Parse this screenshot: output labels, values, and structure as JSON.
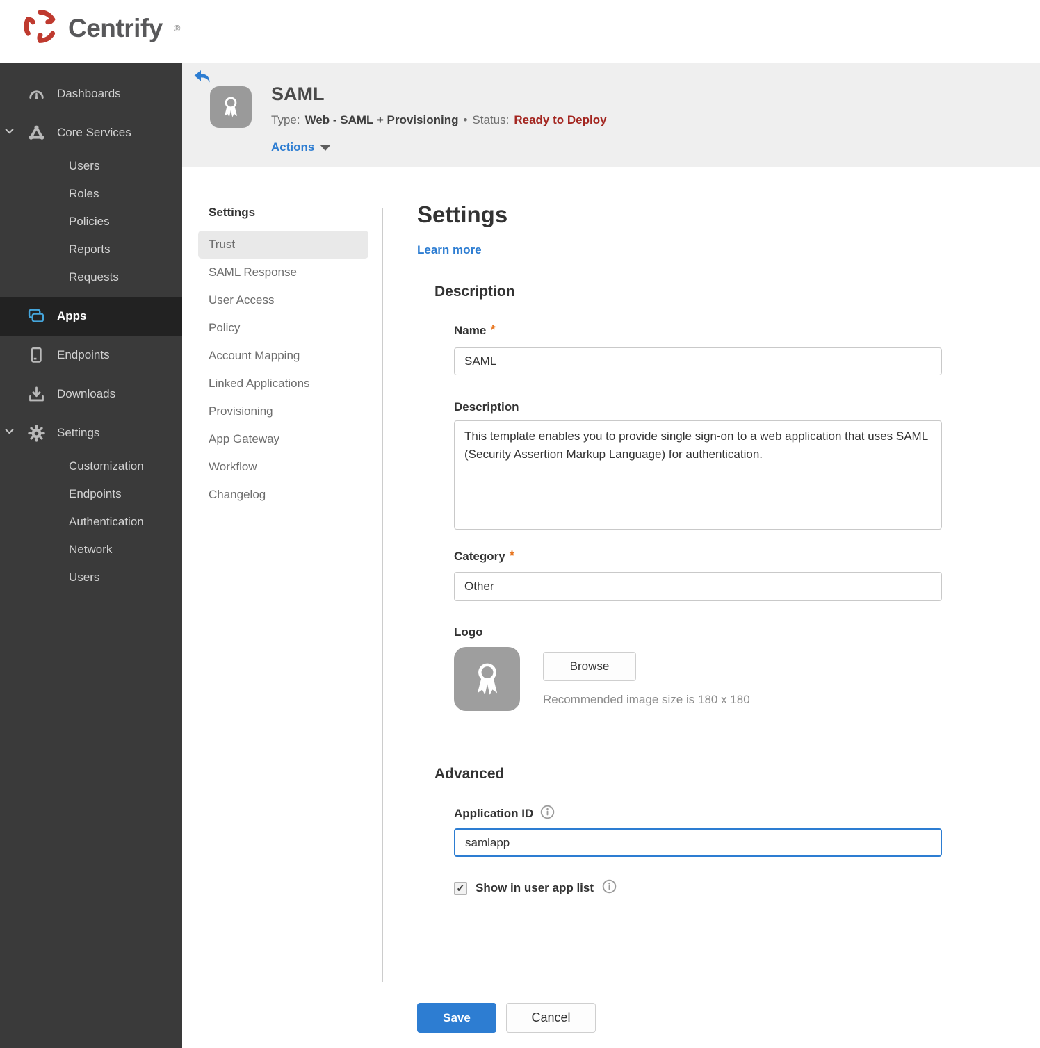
{
  "brand": {
    "name": "Centrify",
    "registered": "®"
  },
  "sidebar": {
    "items": [
      {
        "label": "Dashboards",
        "type": "top",
        "icon": "gauge-icon"
      },
      {
        "label": "Core Services",
        "type": "top",
        "icon": "core-services-icon",
        "expanded": true
      },
      {
        "label": "Users",
        "type": "sub"
      },
      {
        "label": "Roles",
        "type": "sub"
      },
      {
        "label": "Policies",
        "type": "sub"
      },
      {
        "label": "Reports",
        "type": "sub"
      },
      {
        "label": "Requests",
        "type": "sub"
      },
      {
        "label": "Apps",
        "type": "top",
        "icon": "apps-icon",
        "active": true
      },
      {
        "label": "Endpoints",
        "type": "top",
        "icon": "device-icon"
      },
      {
        "label": "Downloads",
        "type": "top",
        "icon": "download-icon"
      },
      {
        "label": "Settings",
        "type": "top",
        "icon": "gear-icon",
        "expanded": true
      },
      {
        "label": "Customization",
        "type": "sub"
      },
      {
        "label": "Endpoints",
        "type": "sub"
      },
      {
        "label": "Authentication",
        "type": "sub"
      },
      {
        "label": "Network",
        "type": "sub"
      },
      {
        "label": "Users",
        "type": "sub"
      }
    ]
  },
  "app_header": {
    "title": "SAML",
    "type_label": "Type:",
    "type_value": "Web - SAML + Provisioning",
    "separator": "•",
    "status_label": "Status:",
    "status_value": "Ready to Deploy",
    "actions_label": "Actions",
    "app_icon": "ribbon-award-icon",
    "back_icon": "back-arrow-icon"
  },
  "subnav": {
    "header": "Settings",
    "active_item": "Trust",
    "items": [
      "Trust",
      "SAML Response",
      "User Access",
      "Policy",
      "Account Mapping",
      "Linked Applications",
      "Provisioning",
      "App Gateway",
      "Workflow",
      "Changelog"
    ]
  },
  "content": {
    "title": "Settings",
    "learn_more_label": "Learn more",
    "description_section": "Description",
    "name_label": "Name",
    "required_mark": "*",
    "name_value": "SAML",
    "description_label": "Description",
    "description_value": "This template enables you to provide single sign-on to a web application that uses SAML (Security Assertion Markup Language) for authentication.",
    "category_label": "Category",
    "category_value": "Other",
    "logo_label": "Logo",
    "browse_label": "Browse",
    "logo_hint": "Recommended image size is 180 x 180",
    "advanced_section": "Advanced",
    "app_id_label": "Application ID",
    "app_id_value": "samlapp",
    "show_in_list_label": "Show in user app list",
    "show_in_list_checked": true,
    "checkmark": "✓",
    "save_label": "Save",
    "cancel_label": "Cancel"
  },
  "colors": {
    "accent_blue": "#2d7dd2",
    "status_red": "#a32620",
    "asterisk_orange": "#e87722",
    "apps_icon_blue": "#45a6dc",
    "brand_red": "#bf3a2f"
  }
}
